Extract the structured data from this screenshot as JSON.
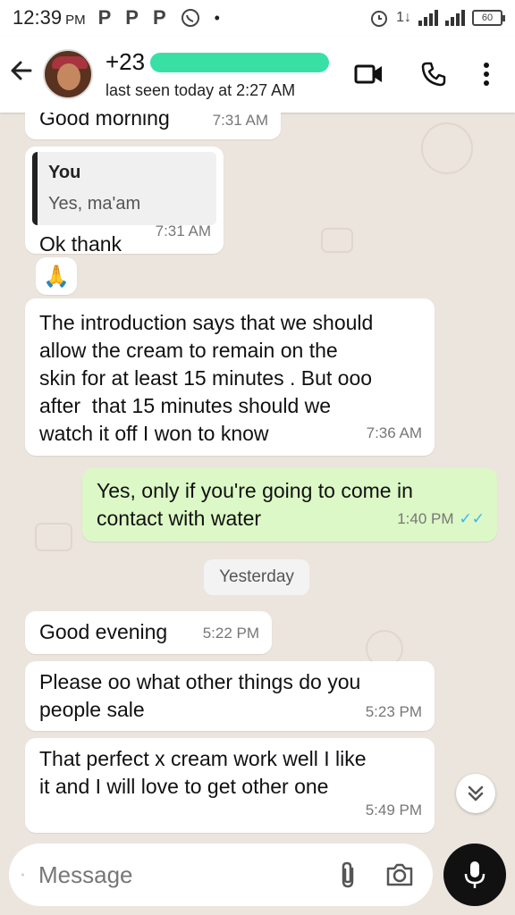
{
  "status_bar": {
    "time": "12:39",
    "ampm": "PM",
    "battery": "60"
  },
  "header": {
    "contact_name": "+23",
    "last_seen": "last seen today at 2:27 AM"
  },
  "messages": [
    {
      "text": "Good morning",
      "time": "7:31 AM"
    },
    {
      "quote_author": "You",
      "quote_text": "Yes, ma'am",
      "text": "Ok thank",
      "time": "7:31 AM"
    },
    {
      "emoji": "🙏"
    },
    {
      "text": "The introduction says that we should\nallow the cream to remain on the\nskin for at least 15 minutes . But ooo\nafter  that 15 minutes should we\nwatch it off I won to know",
      "time": "7:36 AM"
    },
    {
      "text": "Yes, only if you're going to come in\ncontact with water",
      "time": "1:40 PM",
      "ticks": "✓✓"
    },
    {
      "text": "Good evening",
      "time": "5:22 PM"
    },
    {
      "text": "Please oo what other things do you\npeople sale",
      "time": "5:23 PM"
    },
    {
      "text": "That perfect x cream work well I like\nit and I will love to get other one",
      "time": "5:49 PM"
    }
  ],
  "date_separator": "Yesterday",
  "input": {
    "placeholder": "Message"
  },
  "icons": {
    "back": "arrow-left-icon",
    "video": "video-call-icon",
    "call": "phone-icon",
    "menu": "more-vert-icon",
    "emoji": "emoji-icon",
    "attach": "paperclip-icon",
    "camera": "camera-icon",
    "mic": "mic-icon",
    "scroll": "double-chevron-down-icon"
  },
  "colors": {
    "incoming_bubble": "#ffffff",
    "outgoing_bubble": "#dcf8c6",
    "read_ticks": "#34b7f1",
    "redaction": "#39e0a6"
  }
}
